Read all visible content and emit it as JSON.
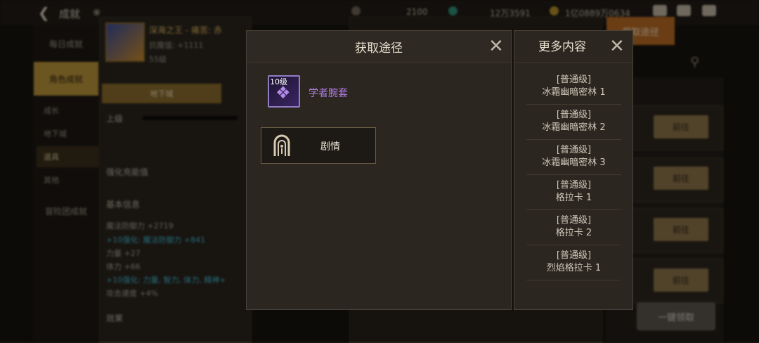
{
  "background": {
    "page_title": "成就",
    "currencies": [
      "2100",
      "12万3591",
      "1亿0889万0634"
    ],
    "sidebar": {
      "tabs": [
        "每日成就",
        "角色成就",
        "冒险团成就"
      ],
      "subtabs": [
        "成长",
        "地下城",
        "道具",
        "其他"
      ]
    },
    "hero": {
      "name": "深海之王 - 痛苦: 赤",
      "stat": "抗魔值: +1111",
      "level": "55级",
      "subtab": "地下城"
    },
    "labels": {
      "upgrade": "上级",
      "enhance": "强化充能值",
      "basic_info": "基本信息",
      "effect": "效果"
    },
    "stats": [
      "魔法防御力 +2719",
      "+10强化: 魔法防御力 +841",
      "力量 +27",
      "体力 +66",
      "+10强化: 力量, 智力, 体力, 精神+",
      "攻击速度 +4%"
    ],
    "right_panel": {
      "orange_button": "获取途径",
      "goto_labels": [
        "前往",
        "前往",
        "前往",
        "前往"
      ],
      "claim_all": "一键领取"
    }
  },
  "acquire_modal": {
    "title": "获取途径",
    "item": {
      "level_badge": "10级",
      "name": "学者腕套"
    },
    "story_button": "剧情"
  },
  "more_modal": {
    "title": "更多内容",
    "items": [
      {
        "tier": "[普通级]",
        "name": "冰霜幽暗密林 1"
      },
      {
        "tier": "[普通级]",
        "name": "冰霜幽暗密林 2"
      },
      {
        "tier": "[普通级]",
        "name": "冰霜幽暗密林 3"
      },
      {
        "tier": "[普通级]",
        "name": "格拉卡 1"
      },
      {
        "tier": "[普通级]",
        "name": "格拉卡 2"
      },
      {
        "tier": "[普通级]",
        "name": "烈焰格拉卡 1"
      }
    ]
  },
  "colors": {
    "accent_gold": "#b8933a",
    "item_purple": "#b27ee3",
    "stat_cyan": "#3fb8d0"
  },
  "icons": [
    "back-arrow-icon",
    "eye-icon",
    "close-icon",
    "magic-item-icon",
    "gate-icon",
    "zoom-icon",
    "mail-icon",
    "chat-icon"
  ]
}
